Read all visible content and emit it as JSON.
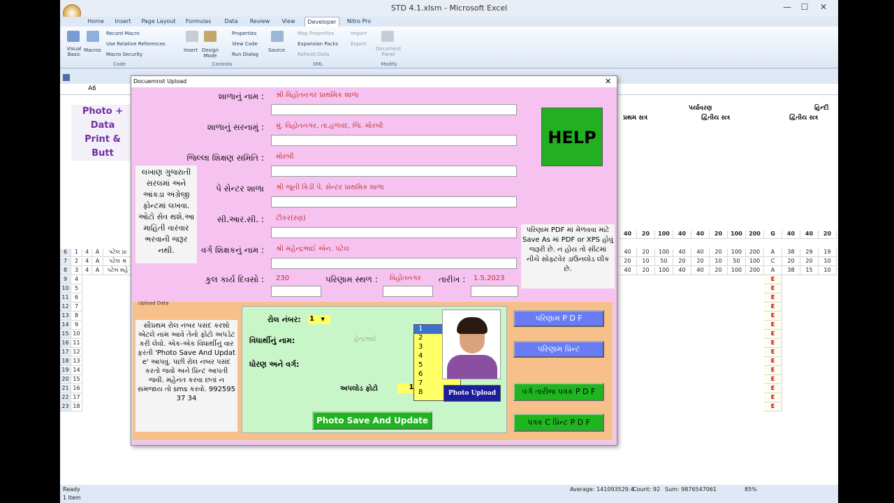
{
  "window": {
    "title": "STD 4.1.xlsm - Microsoft Excel"
  },
  "ribbon_tabs": [
    "Home",
    "Insert",
    "Page Layout",
    "Formulas",
    "Data",
    "Review",
    "View",
    "Developer",
    "Nitro Pro"
  ],
  "ribbon": {
    "code": {
      "visual_basic": "Visual Basic",
      "macros": "Macros",
      "record": "Record Macro",
      "relative": "Use Relative References",
      "security": "Macro Security",
      "group": "Code"
    },
    "controls": {
      "insert": "Insert",
      "design": "Design Mode",
      "properties": "Properties",
      "view_code": "View Code",
      "run_dialog": "Run Dialog",
      "group": "Controls"
    },
    "xml": {
      "source": "Source",
      "map": "Map Properties",
      "expansion": "Expansion Packs",
      "refresh": "Refresh Data",
      "import": "Import",
      "export": "Export",
      "group": "XML"
    },
    "modify": {
      "doc_panel": "Document Panel",
      "group": "Modify"
    }
  },
  "formula_bar": {
    "name_box": "A6"
  },
  "sheet": {
    "left_title": [
      "Photo + Data",
      "Print &",
      "Butt"
    ],
    "right_headers": {
      "paryavaran": "પર્યાવરણ",
      "hindi": "હિન્દી",
      "pratham": "પ્રથમ સત્ર",
      "dvitiy": "દ્વિતીય સત્ર",
      "dvitiy2": "દ્વિતીય સત્ર"
    },
    "col_letters": [
      "AE",
      "AF",
      "AG",
      "AH",
      "AI",
      "AJ",
      "AK",
      "AL",
      "AM",
      "AR",
      "AS",
      "AT"
    ],
    "max_row": [
      "40",
      "20",
      "100",
      "40",
      "40",
      "20",
      "100",
      "200",
      "G",
      "40",
      "40",
      "20"
    ],
    "rows": [
      {
        "n": "6",
        "r": "1",
        "s": "4",
        "d": "A",
        "name": "પટેલ પ્રા",
        "v": [
          "40",
          "20",
          "100",
          "40",
          "40",
          "20",
          "100",
          "200",
          "A",
          "38",
          "29",
          "19"
        ]
      },
      {
        "n": "7",
        "r": "2",
        "s": "4",
        "d": "A",
        "name": "પટેલ શ્ર",
        "v": [
          "20",
          "10",
          "50",
          "20",
          "20",
          "10",
          "50",
          "100",
          "C",
          "20",
          "20",
          "10"
        ]
      },
      {
        "n": "8",
        "r": "3",
        "s": "4",
        "d": "A",
        "name": "પટેલ મહે",
        "v": [
          "40",
          "20",
          "100",
          "40",
          "40",
          "20",
          "100",
          "200",
          "A",
          "38",
          "15",
          "10"
        ]
      }
    ],
    "empty_rows_start": 9,
    "empty_rows_end": 23
  },
  "status": {
    "ready": "Ready",
    "items": "1 item",
    "average": "Average: 141093529.4",
    "count": "Count: 92",
    "sum": "Sum: 9876547061",
    "zoom": "85%"
  },
  "dialog": {
    "title": "Docuemnst Upload",
    "fields": [
      {
        "label": "શાળાનું નામ :",
        "value": "શ્રી વિહોતનગર પ્રાથમિક શાળા"
      },
      {
        "label": "શાળાનું સરનામું :",
        "value": "મું. વિહોતનગર, તા.હળવદ, જિ. મોરબી"
      },
      {
        "label": "જિલ્લા શિક્ષણ સમિતિ :",
        "value": "મોરબી"
      },
      {
        "label": "પે સેન્ટર શાળા",
        "value": "શ્રી જૂની કિડી પે. સેન્ટર પ્રાથમિક શાળા"
      },
      {
        "label": "સી.આર.સી. :",
        "value": "ટીકર(રણ)"
      },
      {
        "label": "વર્ગ શિક્ષકનું નામ :",
        "value": "શ્રી મહેન્દ્રભાઈ એન. પટેલ"
      }
    ],
    "days_label": "કુલ કાર્ય દિવસો :",
    "days_value": "230",
    "place_label": "પરિણામ સ્થળ :",
    "place_value": "વિહોતનગર",
    "date_label": "તારીખ :",
    "date_value": "1.5.2023",
    "help": "HELP",
    "note_left": "લખાણ ગુજરાતી સરલમાં અને આંકડા અંગ્રેજી ફોન્ટમાં લખવા. ઓટો સેવ થશે.આ માહિતી વારંવાર ભરવાની જરૂર નથી.",
    "note_right": "પરિણામ PDF માં મેળવવા માટે Save As માં PDF or XPS હોવું જરૂરી છે. ન હોય તો સીટમાં નીચે સોફ્ટવેર ડાઉનલોડ લીંક છે.",
    "upload_caption": "Upload Data",
    "instructions": "સૌપ્રથમ રોલ નંબર પસંદ કરશો એટલે નામ આવે તેનો ફોટો અપડેટ કરી લેવો. એક-એક વિધાર્થીનું વાર ફરતી 'Photo Save And Updat e' આપવું. પછી રોલ નંબર પસંદ કરતો જવો અને પ્રિન્ટ આપતી જવી. મહેનત કરવા છતાં ન સમજાય તો sms કરવો. 992595 37 34",
    "roll_label": "રોલ નંબર:",
    "roll_value": "1",
    "student_label": "વિધાર્થીનું નામ:",
    "student_value": "હેન્દ્રભાઈ",
    "std_label": "ધોરણ અને વર્ગ:",
    "upload_photo_label": "અપલોડ ફોટો",
    "upload_photo_value": "1",
    "dropdown": [
      "1",
      "2",
      "3",
      "4",
      "5",
      "6",
      "7",
      "8"
    ],
    "photo_upload": "Photo Upload",
    "save_update": "Photo Save And Update",
    "btn_result_pdf": "પરિણામ P D F",
    "btn_result_print": "પરિણામ પ્રિન્ટ",
    "btn_class_pdf": "વર્ગ તારીજ પત્રક P D F",
    "btn_patrak_pdf": "પત્રક C પ્રિન્ટ P D F"
  }
}
